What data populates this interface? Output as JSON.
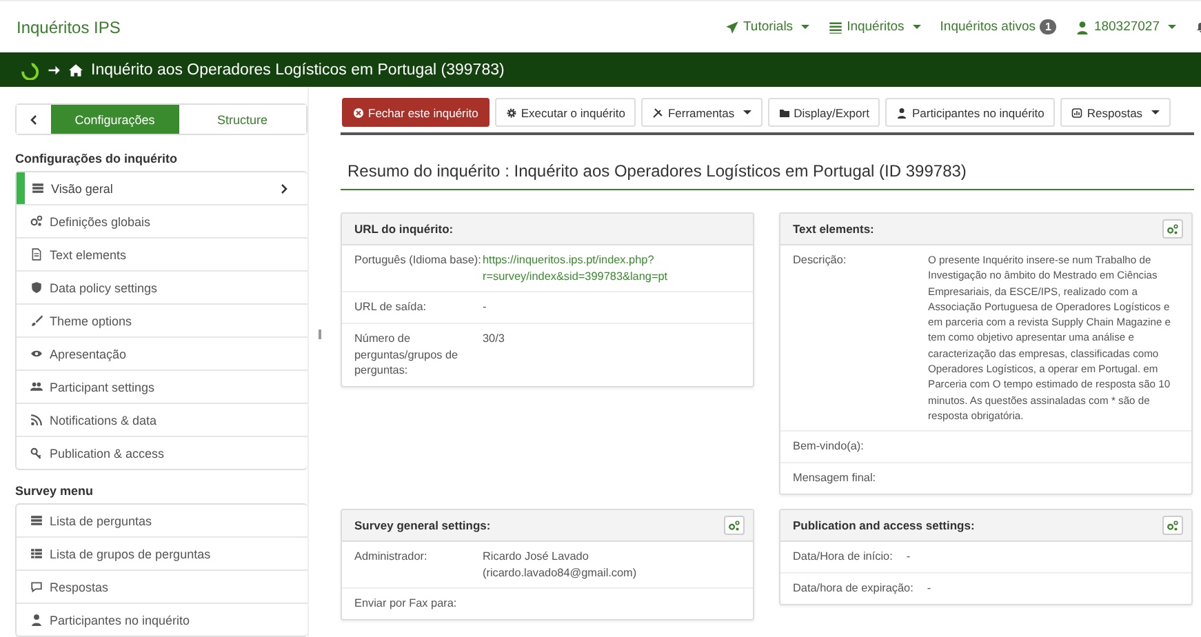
{
  "topbar": {
    "brand": "Inquéritos IPS",
    "nav": [
      {
        "label": "Tutorials",
        "caret": true
      },
      {
        "label": "Inquéritos",
        "caret": true
      },
      {
        "label": "Inquéritos ativos",
        "badge": "1",
        "caret": false
      },
      {
        "label": "180327027",
        "caret": true
      }
    ]
  },
  "breadcrumb": {
    "title": "Inquérito aos Operadores Logísticos em Portugal (399783)"
  },
  "sidebar": {
    "tabs": [
      {
        "label": "Configurações",
        "selected": true
      },
      {
        "label": "Structure",
        "selected": false
      }
    ],
    "sections": [
      {
        "heading": "Configurações do inquérito",
        "items": [
          {
            "label": "Visão geral",
            "selected": true
          },
          {
            "label": "Definições globais",
            "selected": false
          },
          {
            "label": "Text elements",
            "selected": false
          },
          {
            "label": "Data policy settings",
            "selected": false
          },
          {
            "label": "Theme options",
            "selected": false
          },
          {
            "label": "Apresentação",
            "selected": false
          },
          {
            "label": "Participant settings",
            "selected": false
          },
          {
            "label": "Notifications & data",
            "selected": false
          },
          {
            "label": "Publication & access",
            "selected": false
          }
        ]
      },
      {
        "heading": "Survey menu",
        "items": [
          {
            "label": "Lista de perguntas",
            "selected": false
          },
          {
            "label": "Lista de grupos de perguntas",
            "selected": false
          },
          {
            "label": "Respostas",
            "selected": false
          },
          {
            "label": "Participantes no inquérito",
            "selected": false
          }
        ]
      }
    ]
  },
  "toolbar": [
    {
      "label": "Fechar este inquérito",
      "kind": "danger",
      "caret": false
    },
    {
      "label": "Executar o inquérito",
      "kind": "default",
      "caret": false
    },
    {
      "label": "Ferramentas",
      "kind": "default",
      "caret": true
    },
    {
      "label": "Display/Export",
      "kind": "default",
      "caret": false
    },
    {
      "label": "Participantes no inquérito",
      "kind": "default",
      "caret": false
    },
    {
      "label": "Respostas",
      "kind": "default",
      "caret": true
    }
  ],
  "summary_title": "Resumo do inquérito : Inquérito aos Operadores Logísticos em Portugal (ID 399783)",
  "panels": [
    {
      "title": "URL do inquérito:",
      "settings_button": false,
      "rows": [
        {
          "label": "Português (Idioma base):",
          "value": "https://inqueritos.ips.pt/index.php?r=survey/index&sid=399783&lang=pt",
          "kind": "link"
        },
        {
          "label": "URL de saída:",
          "value": "-",
          "kind": "text"
        },
        {
          "label": "Número de perguntas/grupos de perguntas:",
          "value": "30/3",
          "kind": "text"
        }
      ]
    },
    {
      "title": "Text elements:",
      "settings_button": true,
      "rows": [
        {
          "label": "Descrição:",
          "value": "O presente Inquérito insere-se num Trabalho de Investigação no âmbito do Mestrado em Ciências Empresariais, da ESCE/IPS, realizado com a Associação Portuguesa de Operadores Logísticos e em parceria com a revista Supply Chain Magazine e tem como objetivo apresentar uma análise e caracterização das empresas, classificadas como Operadores Logísticos, a operar em Portugal.     em Parceria com O tempo estimado de resposta são 10 minutos. As questões assinaladas com * são de resposta obrigatória.",
          "kind": "text"
        },
        {
          "label": "Bem-vindo(a):"
        },
        {
          "label": "Mensagem final:"
        }
      ]
    },
    {
      "title": "Survey general settings:",
      "settings_button": true,
      "rows": [
        {
          "label": "Administrador:",
          "value": "Ricardo José Lavado (ricardo.lavado84@gmail.com)",
          "kind": "text"
        },
        {
          "label": "Enviar por Fax para:"
        }
      ]
    },
    {
      "title": "Publication and access settings:",
      "settings_button": true,
      "rows": [
        {
          "label": "Data/Hora de início:",
          "value": "-",
          "kind": "text"
        },
        {
          "label": "Data/hora de expiração:",
          "value": "-",
          "kind": "text"
        }
      ]
    }
  ]
}
